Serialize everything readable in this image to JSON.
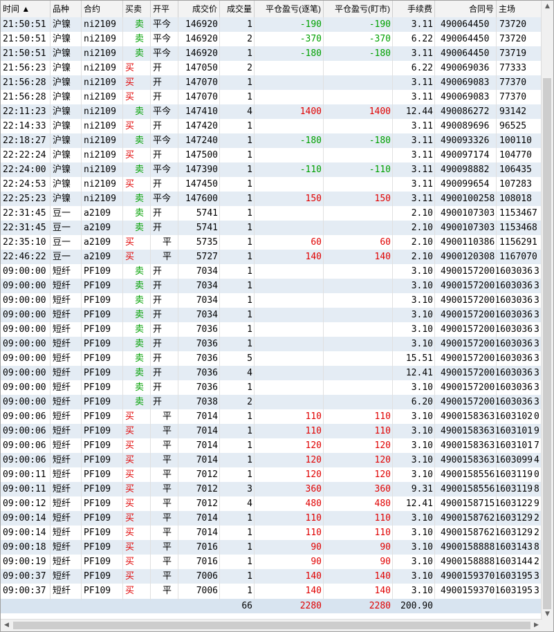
{
  "headers": [
    "时间 ▲",
    "品种",
    "合约",
    "买卖",
    "开平",
    "成交价",
    "成交量",
    "平仓盈亏(逐笔)",
    "平仓盈亏(盯市)",
    "手续费",
    "合同号",
    "主场"
  ],
  "rows": [
    [
      "21:50:51",
      "沪镍",
      "ni2109",
      "卖",
      "平今",
      "146920",
      "1",
      "-190",
      "-190",
      "3.11",
      "490064450",
      "73720"
    ],
    [
      "21:50:51",
      "沪镍",
      "ni2109",
      "卖",
      "平今",
      "146920",
      "2",
      "-370",
      "-370",
      "6.22",
      "490064450",
      "73720"
    ],
    [
      "21:50:51",
      "沪镍",
      "ni2109",
      "卖",
      "平今",
      "146920",
      "1",
      "-180",
      "-180",
      "3.11",
      "490064450",
      "73719"
    ],
    [
      "21:56:23",
      "沪镍",
      "ni2109",
      "买",
      "开",
      "147050",
      "2",
      "",
      "",
      "6.22",
      "490069036",
      "77333"
    ],
    [
      "21:56:28",
      "沪镍",
      "ni2109",
      "买",
      "开",
      "147070",
      "1",
      "",
      "",
      "3.11",
      "490069083",
      "77370"
    ],
    [
      "21:56:28",
      "沪镍",
      "ni2109",
      "买",
      "开",
      "147070",
      "1",
      "",
      "",
      "3.11",
      "490069083",
      "77370"
    ],
    [
      "22:11:23",
      "沪镍",
      "ni2109",
      "卖",
      "平今",
      "147410",
      "4",
      "1400",
      "1400",
      "12.44",
      "490086272",
      "93142"
    ],
    [
      "22:14:33",
      "沪镍",
      "ni2109",
      "买",
      "开",
      "147420",
      "1",
      "",
      "",
      "3.11",
      "490089696",
      "96525"
    ],
    [
      "22:18:27",
      "沪镍",
      "ni2109",
      "卖",
      "平今",
      "147240",
      "1",
      "-180",
      "-180",
      "3.11",
      "490093326",
      "100110"
    ],
    [
      "22:22:24",
      "沪镍",
      "ni2109",
      "买",
      "开",
      "147500",
      "1",
      "",
      "",
      "3.11",
      "490097174",
      "104770"
    ],
    [
      "22:24:00",
      "沪镍",
      "ni2109",
      "卖",
      "平今",
      "147390",
      "1",
      "-110",
      "-110",
      "3.11",
      "490098882",
      "106435"
    ],
    [
      "22:24:53",
      "沪镍",
      "ni2109",
      "买",
      "开",
      "147450",
      "1",
      "",
      "",
      "3.11",
      "490099654",
      "107283"
    ],
    [
      "22:25:23",
      "沪镍",
      "ni2109",
      "卖",
      "平今",
      "147600",
      "1",
      "150",
      "150",
      "3.11",
      "4900100258",
      "108018"
    ],
    [
      "22:31:45",
      "豆一",
      "a2109",
      "卖",
      "开",
      "5741",
      "1",
      "",
      "",
      "2.10",
      "4900107303",
      "1153467"
    ],
    [
      "22:31:45",
      "豆一",
      "a2109",
      "卖",
      "开",
      "5741",
      "1",
      "",
      "",
      "2.10",
      "4900107303",
      "1153468"
    ],
    [
      "22:35:10",
      "豆一",
      "a2109",
      "买",
      "平",
      "5735",
      "1",
      "60",
      "60",
      "2.10",
      "4900110386",
      "1156291"
    ],
    [
      "22:46:22",
      "豆一",
      "a2109",
      "买",
      "平",
      "5727",
      "1",
      "140",
      "140",
      "2.10",
      "4900120308",
      "1167070"
    ],
    [
      "09:00:00",
      "短纤",
      "PF109",
      "卖",
      "开",
      "7034",
      "1",
      "",
      "",
      "3.10",
      "49001572001603036",
      "3"
    ],
    [
      "09:00:00",
      "短纤",
      "PF109",
      "卖",
      "开",
      "7034",
      "1",
      "",
      "",
      "3.10",
      "49001572001603036",
      "3"
    ],
    [
      "09:00:00",
      "短纤",
      "PF109",
      "卖",
      "开",
      "7034",
      "1",
      "",
      "",
      "3.10",
      "49001572001603036",
      "3"
    ],
    [
      "09:00:00",
      "短纤",
      "PF109",
      "卖",
      "开",
      "7034",
      "1",
      "",
      "",
      "3.10",
      "49001572001603036",
      "3"
    ],
    [
      "09:00:00",
      "短纤",
      "PF109",
      "卖",
      "开",
      "7036",
      "1",
      "",
      "",
      "3.10",
      "49001572001603036",
      "3"
    ],
    [
      "09:00:00",
      "短纤",
      "PF109",
      "卖",
      "开",
      "7036",
      "1",
      "",
      "",
      "3.10",
      "49001572001603036",
      "3"
    ],
    [
      "09:00:00",
      "短纤",
      "PF109",
      "卖",
      "开",
      "7036",
      "5",
      "",
      "",
      "15.51",
      "49001572001603036",
      "3"
    ],
    [
      "09:00:00",
      "短纤",
      "PF109",
      "卖",
      "开",
      "7036",
      "4",
      "",
      "",
      "12.41",
      "49001572001603036",
      "3"
    ],
    [
      "09:00:00",
      "短纤",
      "PF109",
      "卖",
      "开",
      "7036",
      "1",
      "",
      "",
      "3.10",
      "49001572001603036",
      "3"
    ],
    [
      "09:00:00",
      "短纤",
      "PF109",
      "卖",
      "开",
      "7038",
      "2",
      "",
      "",
      "6.20",
      "49001572001603036",
      "3"
    ],
    [
      "09:00:06",
      "短纤",
      "PF109",
      "买",
      "平",
      "7014",
      "1",
      "110",
      "110",
      "3.10",
      "49001583631603102",
      "0"
    ],
    [
      "09:00:06",
      "短纤",
      "PF109",
      "买",
      "平",
      "7014",
      "1",
      "110",
      "110",
      "3.10",
      "49001583631603101",
      "9"
    ],
    [
      "09:00:06",
      "短纤",
      "PF109",
      "买",
      "平",
      "7014",
      "1",
      "120",
      "120",
      "3.10",
      "49001583631603101",
      "7"
    ],
    [
      "09:00:06",
      "短纤",
      "PF109",
      "买",
      "平",
      "7014",
      "1",
      "120",
      "120",
      "3.10",
      "49001583631603099",
      "4"
    ],
    [
      "09:00:11",
      "短纤",
      "PF109",
      "买",
      "平",
      "7012",
      "1",
      "120",
      "120",
      "3.10",
      "49001585561603119",
      "0"
    ],
    [
      "09:00:11",
      "短纤",
      "PF109",
      "买",
      "平",
      "7012",
      "3",
      "360",
      "360",
      "9.31",
      "49001585561603119",
      "8"
    ],
    [
      "09:00:12",
      "短纤",
      "PF109",
      "买",
      "平",
      "7012",
      "4",
      "480",
      "480",
      "12.41",
      "49001587151603122",
      "9"
    ],
    [
      "09:00:14",
      "短纤",
      "PF109",
      "买",
      "平",
      "7014",
      "1",
      "110",
      "110",
      "3.10",
      "49001587621603129",
      "2"
    ],
    [
      "09:00:14",
      "短纤",
      "PF109",
      "买",
      "平",
      "7014",
      "1",
      "110",
      "110",
      "3.10",
      "49001587621603129",
      "2"
    ],
    [
      "09:00:18",
      "短纤",
      "PF109",
      "买",
      "平",
      "7016",
      "1",
      "90",
      "90",
      "3.10",
      "49001588881603143",
      "8"
    ],
    [
      "09:00:19",
      "短纤",
      "PF109",
      "买",
      "平",
      "7016",
      "1",
      "90",
      "90",
      "3.10",
      "49001588881603144",
      "2"
    ],
    [
      "09:00:37",
      "短纤",
      "PF109",
      "买",
      "平",
      "7006",
      "1",
      "140",
      "140",
      "3.10",
      "49001593701603195",
      "3"
    ],
    [
      "09:00:37",
      "短纤",
      "PF109",
      "买",
      "平",
      "7006",
      "1",
      "140",
      "140",
      "3.10",
      "49001593701603195",
      "3"
    ]
  ],
  "totals": {
    "volume": "66",
    "pnl_trade": "2280",
    "pnl_mtm": "2280",
    "fee": "200.90"
  },
  "colors": {
    "buy": "#e00000",
    "sell": "#00a000",
    "profit": "#e00000",
    "loss": "#00a000",
    "row_alt": "#e4ecf4"
  },
  "icons": {
    "scroll_up": "triangle-up-icon",
    "scroll_down": "triangle-down-icon",
    "scroll_left": "triangle-left-icon",
    "scroll_right": "triangle-right-icon"
  },
  "arrows": {
    "up": "▲",
    "down": "▼",
    "left": "◀",
    "right": "▶"
  }
}
